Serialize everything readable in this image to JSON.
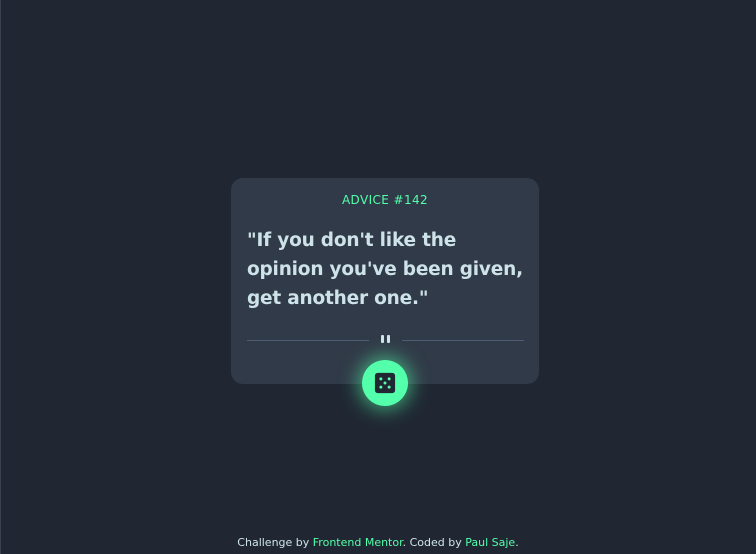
{
  "card": {
    "advice_id": "ADVICE #142",
    "quote": "\"If you don't like the opinion you've been given, get another one.\""
  },
  "divider": {
    "icon": "pause-icon"
  },
  "button": {
    "icon": "dice-icon"
  },
  "footer": {
    "prefix": "Challenge by ",
    "link1": "Frontend Mentor",
    "middle": ". Coded by ",
    "link2": "Paul Saje",
    "suffix": "."
  },
  "colors": {
    "background": "#202733",
    "card": "#313a48",
    "accent": "#53ffaa",
    "text": "#cee3e9",
    "divider": "#4f5d74"
  }
}
